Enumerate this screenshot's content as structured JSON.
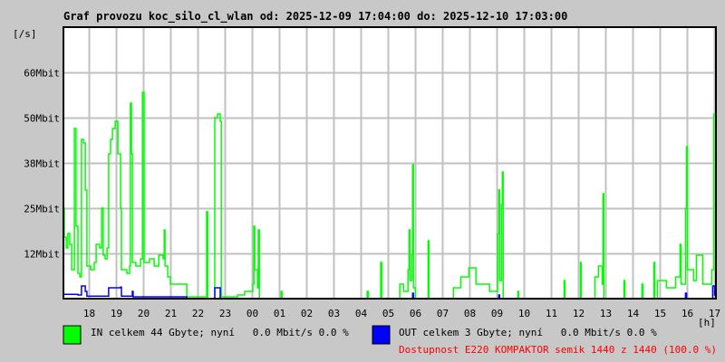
{
  "chart_data": {
    "type": "line",
    "title": "Graf provozu koc_silo_cl_wlan od: 2025-12-09 17:04:00 do: 2025-12-10 17:03:00",
    "ylabel": "[/s]",
    "xlabel": "[h]",
    "x_unit": "hour (continuous, 24+ = next day)",
    "xlim": [
      17.067,
      41.05
    ],
    "ylim": [
      0,
      75
    ],
    "y_unit": "Mbit/s",
    "grid": true,
    "yticks": [
      {
        "value": 12.5,
        "label": "12Mbit"
      },
      {
        "value": 25,
        "label": "25Mbit"
      },
      {
        "value": 37.5,
        "label": "38Mbit"
      },
      {
        "value": 50,
        "label": "50Mbit"
      },
      {
        "value": 62.5,
        "label": "60Mbit"
      }
    ],
    "xticks": [
      {
        "value": 18,
        "label": "18"
      },
      {
        "value": 19,
        "label": "19"
      },
      {
        "value": 20,
        "label": "20"
      },
      {
        "value": 21,
        "label": "21"
      },
      {
        "value": 22,
        "label": "22"
      },
      {
        "value": 23,
        "label": "23"
      },
      {
        "value": 24,
        "label": "00"
      },
      {
        "value": 25,
        "label": "01"
      },
      {
        "value": 26,
        "label": "02"
      },
      {
        "value": 27,
        "label": "03"
      },
      {
        "value": 28,
        "label": "04"
      },
      {
        "value": 29,
        "label": "05"
      },
      {
        "value": 30,
        "label": "06"
      },
      {
        "value": 31,
        "label": "07"
      },
      {
        "value": 32,
        "label": "08"
      },
      {
        "value": 33,
        "label": "09"
      },
      {
        "value": 34,
        "label": "10"
      },
      {
        "value": 35,
        "label": "11"
      },
      {
        "value": 36,
        "label": "12"
      },
      {
        "value": 37,
        "label": "13"
      },
      {
        "value": 38,
        "label": "14"
      },
      {
        "value": 39,
        "label": "15"
      },
      {
        "value": 40,
        "label": "16"
      },
      {
        "value": 41,
        "label": "17"
      }
    ],
    "series": [
      {
        "name": "IN",
        "color": "#00ff00",
        "legend": "IN celkem 44 Gbyte; nyní   0.0 Mbit/s 0.0 %",
        "points": [
          [
            17.07,
            25
          ],
          [
            17.1,
            17
          ],
          [
            17.17,
            14
          ],
          [
            17.23,
            18
          ],
          [
            17.3,
            15
          ],
          [
            17.37,
            8
          ],
          [
            17.47,
            47
          ],
          [
            17.53,
            20
          ],
          [
            17.6,
            7
          ],
          [
            17.67,
            6
          ],
          [
            17.73,
            44
          ],
          [
            17.8,
            43
          ],
          [
            17.87,
            30
          ],
          [
            17.93,
            9
          ],
          [
            18.07,
            8
          ],
          [
            18.2,
            10
          ],
          [
            18.27,
            15
          ],
          [
            18.4,
            14
          ],
          [
            18.47,
            25
          ],
          [
            18.53,
            12
          ],
          [
            18.6,
            11
          ],
          [
            18.67,
            14
          ],
          [
            18.73,
            40
          ],
          [
            18.8,
            44
          ],
          [
            18.87,
            47
          ],
          [
            18.97,
            49
          ],
          [
            19.07,
            40
          ],
          [
            19.17,
            25
          ],
          [
            19.2,
            8
          ],
          [
            19.4,
            7
          ],
          [
            19.5,
            9
          ],
          [
            19.53,
            54
          ],
          [
            19.57,
            40
          ],
          [
            19.6,
            10
          ],
          [
            19.73,
            9
          ],
          [
            19.9,
            11
          ],
          [
            19.97,
            57
          ],
          [
            20.03,
            10
          ],
          [
            20.23,
            11
          ],
          [
            20.4,
            9
          ],
          [
            20.57,
            12
          ],
          [
            20.73,
            11
          ],
          [
            20.77,
            19
          ],
          [
            20.8,
            9
          ],
          [
            20.9,
            6
          ],
          [
            21.0,
            4
          ],
          [
            21.57,
            4
          ],
          [
            21.6,
            0.5
          ],
          [
            22.3,
            0.5
          ],
          [
            22.33,
            24
          ],
          [
            22.37,
            0
          ],
          [
            22.6,
            0
          ],
          [
            22.63,
            50
          ],
          [
            22.73,
            51
          ],
          [
            22.83,
            49
          ],
          [
            22.87,
            0.5
          ],
          [
            23.47,
            1
          ],
          [
            23.73,
            2
          ],
          [
            24.03,
            4
          ],
          [
            24.07,
            20
          ],
          [
            24.1,
            8
          ],
          [
            24.2,
            3
          ],
          [
            24.23,
            19
          ],
          [
            24.27,
            0
          ],
          [
            25.07,
            2
          ],
          [
            25.1,
            0
          ],
          [
            28.23,
            2
          ],
          [
            28.27,
            0
          ],
          [
            28.73,
            10
          ],
          [
            28.77,
            0
          ],
          [
            29.43,
            4
          ],
          [
            29.57,
            2
          ],
          [
            29.73,
            8
          ],
          [
            29.77,
            19
          ],
          [
            29.8,
            5
          ],
          [
            29.87,
            12
          ],
          [
            29.9,
            37
          ],
          [
            29.93,
            3
          ],
          [
            30.0,
            0
          ],
          [
            30.47,
            16
          ],
          [
            30.5,
            0
          ],
          [
            31.4,
            3
          ],
          [
            31.67,
            6
          ],
          [
            31.97,
            8.5
          ],
          [
            32.23,
            4
          ],
          [
            32.73,
            2
          ],
          [
            33.03,
            18
          ],
          [
            33.07,
            30
          ],
          [
            33.1,
            5
          ],
          [
            33.17,
            26
          ],
          [
            33.2,
            35
          ],
          [
            33.23,
            0
          ],
          [
            33.77,
            2
          ],
          [
            33.8,
            0
          ],
          [
            35.47,
            5
          ],
          [
            35.5,
            0
          ],
          [
            36.07,
            10
          ],
          [
            36.1,
            0
          ],
          [
            36.6,
            6
          ],
          [
            36.73,
            9
          ],
          [
            36.87,
            4
          ],
          [
            36.9,
            29
          ],
          [
            36.93,
            0
          ],
          [
            37.67,
            5
          ],
          [
            37.7,
            0
          ],
          [
            38.33,
            4
          ],
          [
            38.37,
            0
          ],
          [
            38.77,
            10
          ],
          [
            38.8,
            0
          ],
          [
            38.9,
            5
          ],
          [
            39.23,
            3
          ],
          [
            39.57,
            6
          ],
          [
            39.73,
            15
          ],
          [
            39.77,
            4
          ],
          [
            39.93,
            25
          ],
          [
            39.97,
            42
          ],
          [
            40.0,
            8
          ],
          [
            40.23,
            5
          ],
          [
            40.33,
            12
          ],
          [
            40.57,
            4
          ],
          [
            40.9,
            8
          ],
          [
            40.97,
            51
          ],
          [
            41.05,
            40
          ]
        ]
      },
      {
        "name": "OUT",
        "color": "#0000ff",
        "legend": "OUT celkem 3 Gbyte; nyní   0.0 Mbit/s 0.0 %",
        "points": [
          [
            17.07,
            1.2
          ],
          [
            17.6,
            1
          ],
          [
            17.73,
            3.5
          ],
          [
            17.87,
            2
          ],
          [
            17.93,
            0.7
          ],
          [
            18.73,
            3
          ],
          [
            19.17,
            3.2
          ],
          [
            19.2,
            0.7
          ],
          [
            19.6,
            2
          ],
          [
            19.63,
            0.5
          ],
          [
            21.6,
            0
          ],
          [
            22.63,
            3
          ],
          [
            22.83,
            0
          ],
          [
            29.9,
            1.5
          ],
          [
            29.93,
            0
          ],
          [
            33.07,
            1
          ],
          [
            33.1,
            0
          ],
          [
            39.93,
            1.5
          ],
          [
            39.97,
            0
          ],
          [
            40.93,
            3.5
          ],
          [
            41.0,
            1
          ],
          [
            41.05,
            1
          ]
        ]
      }
    ],
    "annotation": "Dostupnost E220 KOMPAKTOR semik 1440 z 1440 (100.0 %)",
    "annotation_color": "#ff0000"
  }
}
